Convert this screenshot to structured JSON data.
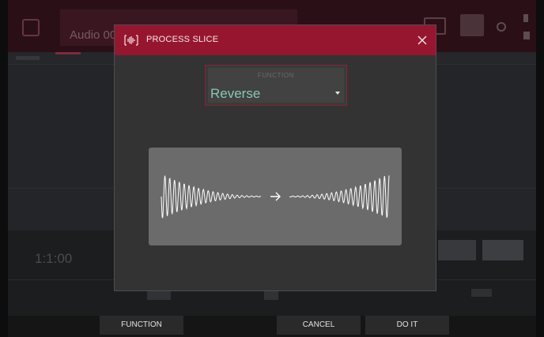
{
  "background": {
    "header_field_text": "Audio 00",
    "time_display": "1:1:00",
    "value_left": "1:00"
  },
  "modal": {
    "title": "PROCESS SLICE",
    "icon": "slice-waveform-icon",
    "close_icon": "close-icon",
    "function_select": {
      "label": "FUNCTION",
      "value": "Reverse"
    },
    "preview_icon": "reverse-waveform-illustration"
  },
  "softkeys": {
    "function_label": "FUNCTION",
    "cancel_label": "CANCEL",
    "do_it_label": "DO IT"
  },
  "colors": {
    "header_red": "#97162f",
    "accent_teal": "#87c8b3",
    "modal_bg": "#333333",
    "preview_bg": "#6b6b6b"
  }
}
